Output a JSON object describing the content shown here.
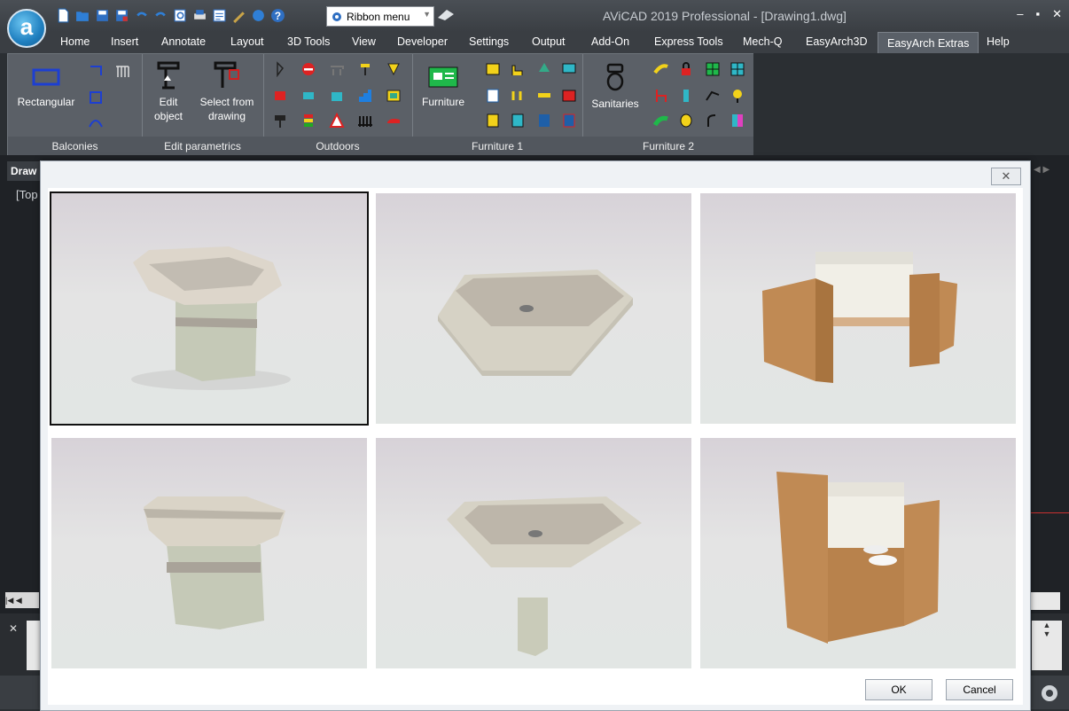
{
  "app": {
    "title": "AViCAD 2019 Professional - [Drawing1.dwg]",
    "logo_letter": "a",
    "ribbon_select": "Ribbon menu"
  },
  "menu": {
    "tabs": [
      "Home",
      "Insert",
      "Annotate",
      "Layout",
      "3D Tools",
      "View",
      "Developer",
      "Settings",
      "Output",
      "Add-On",
      "Express Tools",
      "Mech-Q",
      "EasyArch3D",
      "EasyArch Extras",
      "Help"
    ],
    "active": "EasyArch Extras"
  },
  "ribbon": {
    "balconies": {
      "label": "Balconies",
      "rect_btn": "Rectangular"
    },
    "edit_parametrics": {
      "label": "Edit parametrics",
      "edit_btn": "Edit object",
      "select_btn": "Select from drawing"
    },
    "outdoors": {
      "label": "Outdoors"
    },
    "furniture1": {
      "label": "Furniture 1",
      "furniture_btn": "Furniture"
    },
    "furniture2": {
      "label": "Furniture 2",
      "sanitaries_btn": "Sanitaries"
    }
  },
  "workspace": {
    "doc_tab": "Draw",
    "view_label": "[Top"
  },
  "dialog": {
    "close_glyph": "✕",
    "ok": "OK",
    "cancel": "Cancel",
    "thumbnails": [
      {
        "name": "washbasin-pedestal",
        "selected": true
      },
      {
        "name": "washbasin-wall",
        "selected": false
      },
      {
        "name": "vanity-cabinet",
        "selected": false
      },
      {
        "name": "wc-pedestal",
        "selected": false
      },
      {
        "name": "washbasin-column",
        "selected": false
      },
      {
        "name": "vanity-double",
        "selected": false
      }
    ]
  },
  "colors": {
    "accent": "#1e7fc4",
    "ribbon_bg": "#5b6067",
    "dialog_bg": "#eff2f5"
  }
}
